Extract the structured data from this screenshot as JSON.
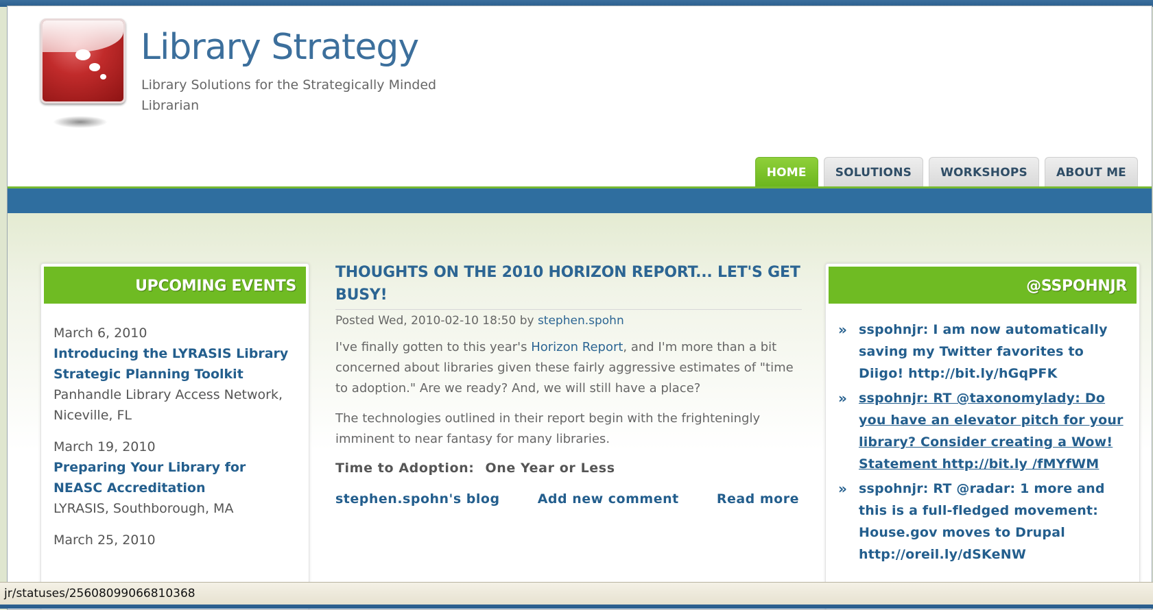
{
  "site": {
    "title": "Library Strategy",
    "slogan": "Library Solutions for the Strategically Minded Librarian"
  },
  "nav": {
    "tabs": [
      {
        "label": "HOME",
        "active": true
      },
      {
        "label": "SOLUTIONS",
        "active": false
      },
      {
        "label": "WORKSHOPS",
        "active": false
      },
      {
        "label": "ABOUT ME",
        "active": false
      }
    ]
  },
  "events": {
    "title": "UPCOMING EVENTS",
    "items": [
      {
        "date": "March 6, 2010",
        "title": "Introducing the LYRASIS Library Strategic Planning Toolkit",
        "place": "Panhandle Library Access Network, Niceville, FL"
      },
      {
        "date": "March 19, 2010",
        "title": "Preparing Your Library for NEASC Accreditation",
        "place": "LYRASIS, Southborough, MA"
      },
      {
        "date": "March 25, 2010",
        "title": "",
        "place": ""
      }
    ]
  },
  "post": {
    "title": "THOUGHTS ON THE 2010 HORIZON REPORT... LET'S GET BUSY!",
    "meta_prefix": "Posted Wed, 2010-02-10 18:50 by",
    "author": "stephen.spohn",
    "p1_before": "I've finally gotten to this year's",
    "p1_link": "Horizon Report",
    "p1_after": ", and I'm more than a bit concerned about libraries given these fairly aggressive estimates of \"time to adoption.\"  Are we ready?  And, we will still have a place?",
    "p2": "The technologies outlined in their report begin with the frighteningly imminent to near fantasy for many libraries.",
    "adoption_label": "Time to Adoption:",
    "adoption_value": "One Year or Less",
    "links": {
      "blog": "stephen.spohn's blog",
      "comment": "Add new comment",
      "read_more": "Read more"
    }
  },
  "twitter": {
    "title": "@SSPOHNJR",
    "tweets": [
      {
        "text": "sspohnjr: I am now automatically saving my Twitter favorites to Diigo! http://bit.ly/hGqPFK",
        "underlined": false
      },
      {
        "text": "sspohnjr: RT @taxonomylady: Do you have an elevator pitch for your library? Consider creating a Wow! Statement http://bit.ly /fMYfWM",
        "underlined": true
      },
      {
        "text": "sspohnjr: RT @radar: 1 more and this is a full-fledged movement: House.gov moves to Drupal http://oreil.ly/dSKeNW",
        "underlined": false
      }
    ]
  },
  "statusbar": {
    "text": "jr/statuses/25608099066810368"
  },
  "colors": {
    "brand_blue": "#2f6e9f",
    "accent_green": "#6fbb23",
    "link_blue": "#235e8d"
  }
}
